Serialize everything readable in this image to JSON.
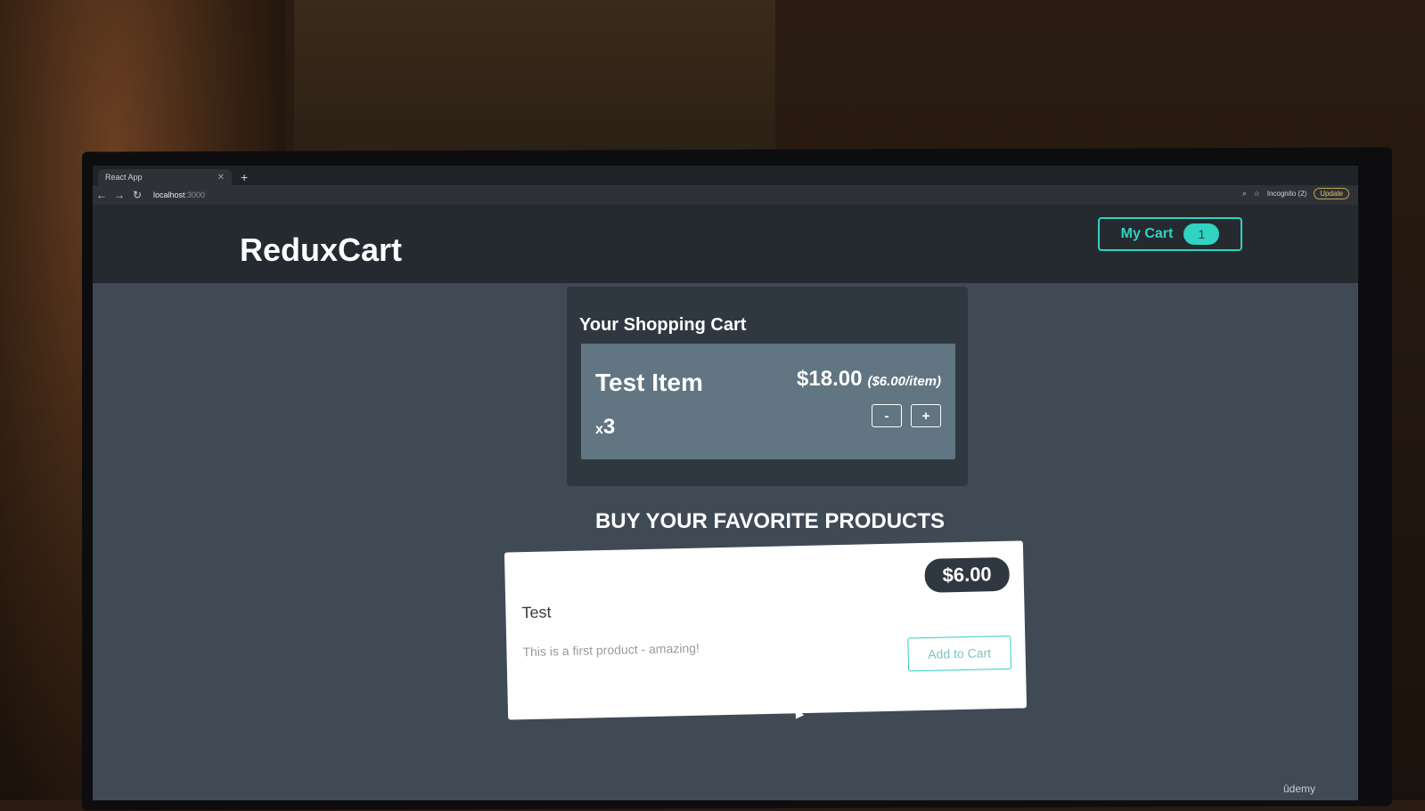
{
  "browser": {
    "tab_title": "React App",
    "tab_close": "✕",
    "new_tab": "+",
    "url_host": "localhost",
    "url_port": ":3000",
    "profile": "Incognito (2)",
    "update_label": "Update"
  },
  "header": {
    "brand": "ReduxCart",
    "cart_label": "My Cart",
    "cart_count": "1"
  },
  "cart": {
    "title": "Your Shopping Cart",
    "items": [
      {
        "name": "Test Item",
        "total": "$18.00",
        "per_item": "($6.00/item)",
        "qty_prefix": "x",
        "quantity": "3",
        "decrement_label": "-",
        "increment_label": "+"
      }
    ]
  },
  "products": {
    "heading": "BUY YOUR FAVORITE PRODUCTS",
    "list": [
      {
        "title": "Test",
        "price": "$6.00",
        "description": "This is a first product - amazing!",
        "add_label": "Add to Cart"
      }
    ]
  },
  "watermark": "ûdemy",
  "colors": {
    "accent": "#2fd3c0",
    "header_bg": "#252a30",
    "page_bg": "#3f4a55",
    "cart_panel_bg": "#2f3840",
    "cart_item_bg": "#617582"
  }
}
